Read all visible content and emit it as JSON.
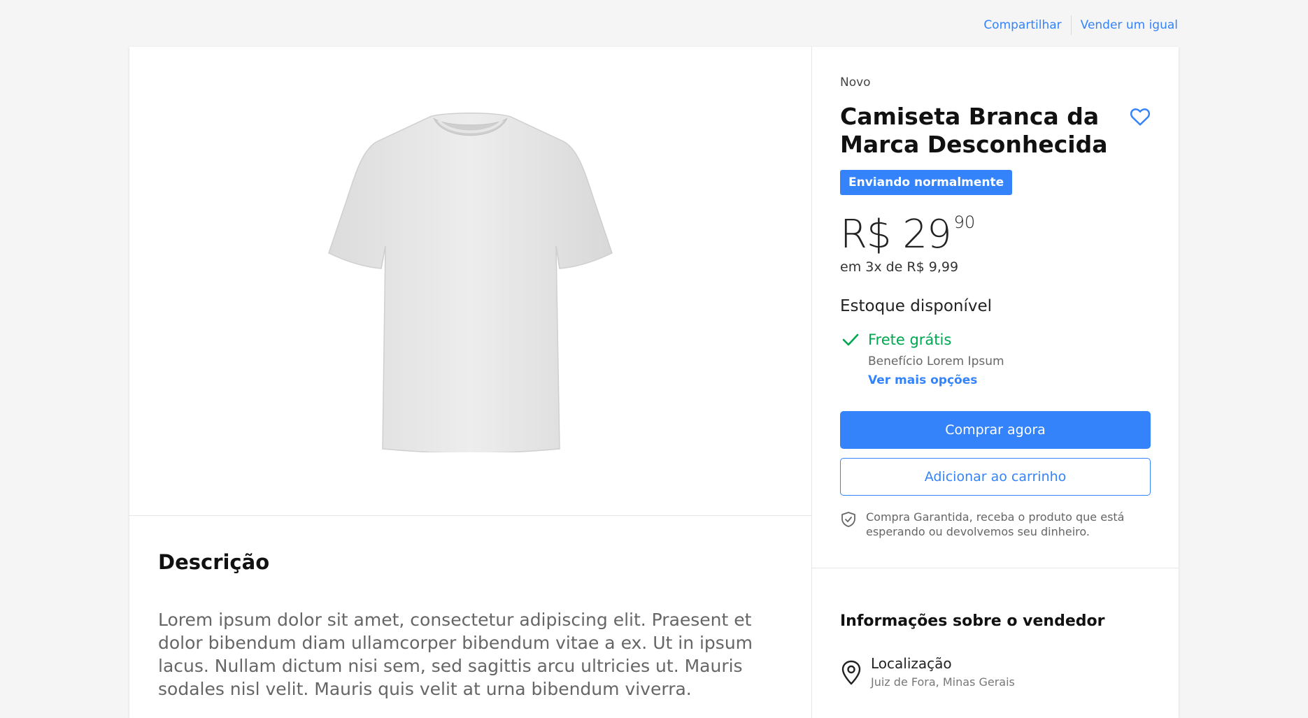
{
  "header": {
    "share_label": "Compartilhar",
    "sell_label": "Vender um igual"
  },
  "product": {
    "condition": "Novo",
    "title": "Camiseta Branca da Marca Desconhecida",
    "shipping_badge": "Enviando normalmente",
    "price_main": "R$ 29",
    "price_cents": "90",
    "installments": "em 3x de R$ 9,99",
    "stock": "Estoque disponível",
    "shipping_free": "Frete grátis",
    "shipping_benefit": "Benefício Lorem Ipsum",
    "more_options": "Ver mais opções",
    "buy_label": "Comprar agora",
    "cart_label": "Adicionar ao carrinho",
    "guarantee": "Compra Garantida, receba o produto que está esperando ou devolvemos seu dinheiro."
  },
  "description": {
    "title": "Descrição",
    "text": "Lorem ipsum dolor sit amet, consectetur adipiscing elit. Praesent et dolor bibendum diam ullamcorper bibendum vitae a ex. Ut in ipsum lacus. Nullam dictum nisi sem, sed sagittis arcu ultricies ut. Mauris sodales nisl velit. Mauris quis velit at urna bibendum viverra."
  },
  "seller": {
    "title": "Informações sobre o vendedor",
    "location_label": "Localização",
    "location_value": "Juiz de Fora, Minas Gerais"
  },
  "icons": {
    "favorite": "heart-icon",
    "shipping": "check-icon",
    "guarantee": "shield-check-icon",
    "location": "location-pin-icon"
  },
  "colors": {
    "accent": "#3483fa",
    "success": "#00a650",
    "background": "#f5f5f5"
  }
}
